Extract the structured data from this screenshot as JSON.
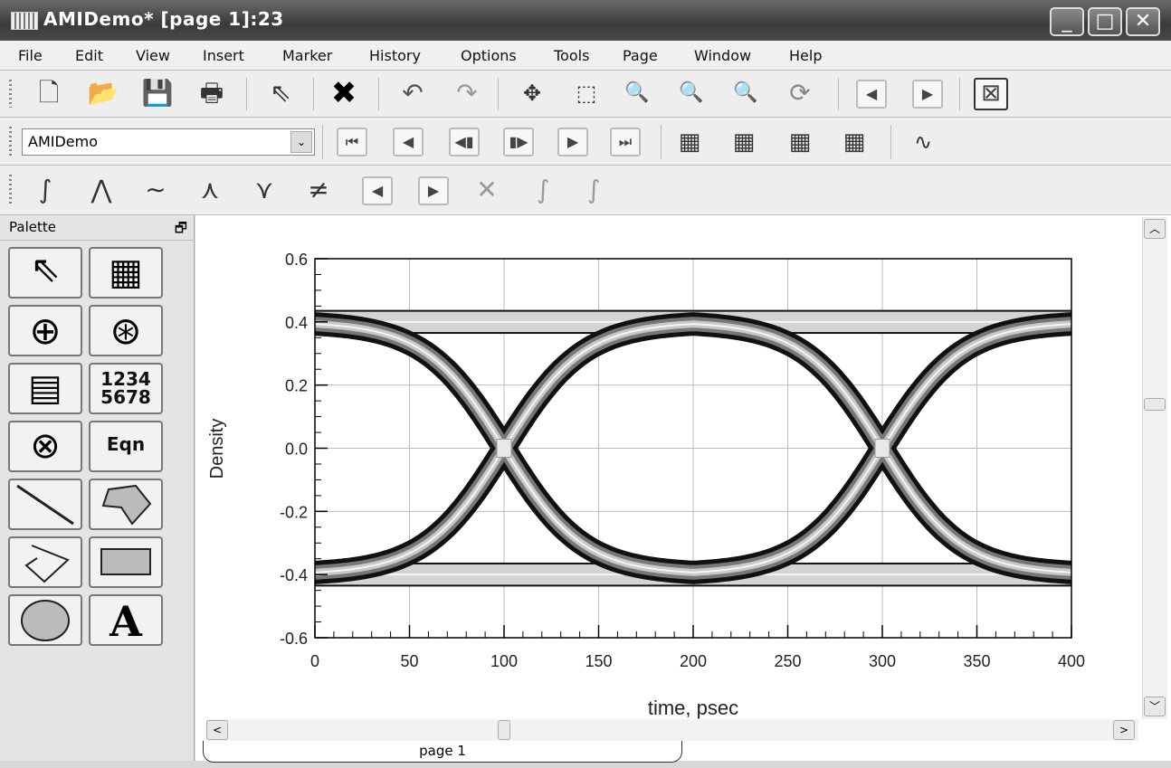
{
  "window": {
    "title": "AMIDemo* [page 1]:23",
    "minimize": "_",
    "maximize": "□",
    "close": "✕"
  },
  "menu": [
    "File",
    "Edit",
    "View",
    "Insert",
    "Marker",
    "History",
    "Options",
    "Tools",
    "Page",
    "Window",
    "Help"
  ],
  "toolbar2": {
    "dataset": "AMIDemo"
  },
  "palette": {
    "title": "Palette",
    "numbers_label": "1234\n5678",
    "numbers_line1": "1234",
    "numbers_line2": "5678",
    "equation_label": "Eqn",
    "text_label": "A"
  },
  "tab": {
    "label": "page 1"
  },
  "chart_data": {
    "type": "eye-diagram",
    "xlabel": "time, psec",
    "ylabel": "Density",
    "xlim": [
      0,
      400
    ],
    "ylim": [
      -0.6,
      0.6
    ],
    "x_ticks": [
      "0",
      "50",
      "100",
      "150",
      "200",
      "250",
      "300",
      "350",
      "400"
    ],
    "y_ticks": [
      "0.6",
      "0.4",
      "0.2",
      "0.0",
      "-0.2",
      "-0.4",
      "-0.6"
    ],
    "grid": true,
    "high_level": 0.4,
    "low_level": -0.4,
    "crossing_times": [
      100,
      300
    ],
    "unit_interval": 200,
    "crossing_level": 0.0
  }
}
